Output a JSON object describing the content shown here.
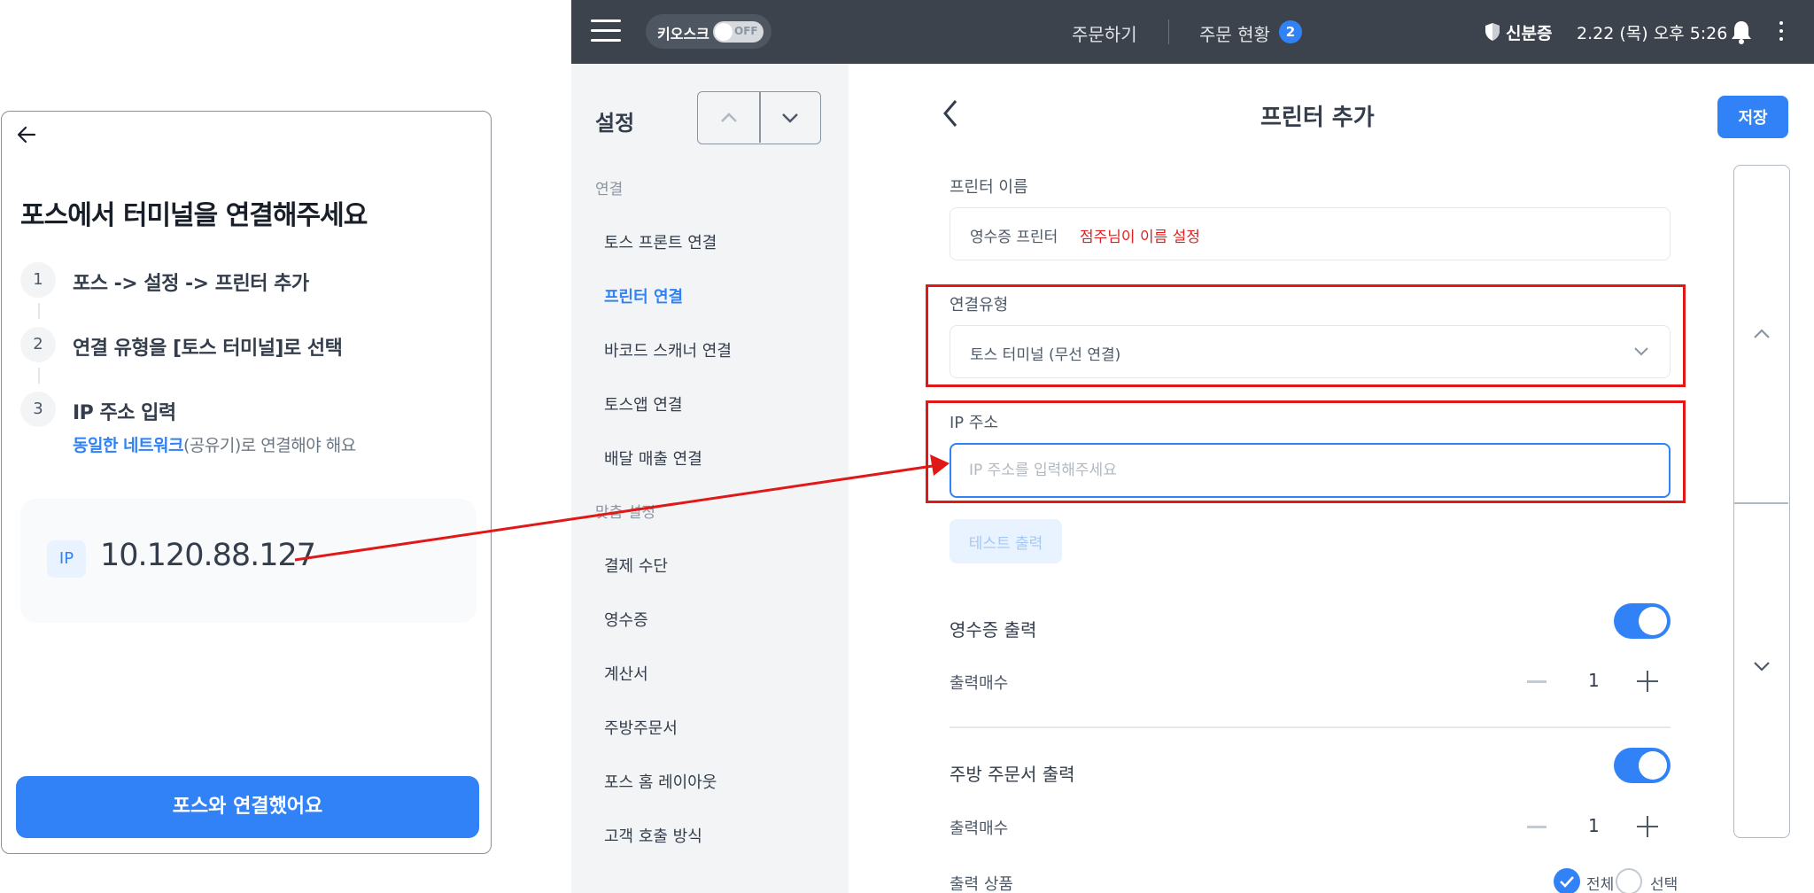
{
  "phone": {
    "title": "포스에서 터미널을 연결해주세요",
    "steps": [
      {
        "num": "1",
        "text": "포스 -> 설정 -> 프린터 추가"
      },
      {
        "num": "2",
        "text": "연결 유형을 [토스 터미널]로 선택"
      },
      {
        "num": "3",
        "text": "IP 주소 입력",
        "sub_highlight": "동일한 네트워크",
        "sub_rest": "(공유기)로 연결해야 해요"
      }
    ],
    "ip_tag": "IP",
    "ip_address": "10.120.88.127",
    "cta_label": "포스와 연결했어요",
    "icons": {
      "back": "arrow-left-icon"
    }
  },
  "topbar": {
    "kiosk_label": "키오스크",
    "kiosk_state": "OFF",
    "nav_order": "주문하기",
    "nav_status": "주문 현황",
    "status_count": "2",
    "id_check": "신분증",
    "datetime": "2.22 (목) 오후 5:26"
  },
  "sidebar": {
    "title": "설정",
    "sections": [
      {
        "label": "연결",
        "items": [
          "토스 프론트 연결",
          "프린터 연결",
          "바코드 스캐너 연결",
          "토스앱 연결",
          "배달 매출 연결"
        ]
      },
      {
        "label": "맞춤 설정",
        "items": [
          "결제 수단",
          "영수증",
          "계산서",
          "주방주문서",
          "포스 홈 레이아웃",
          "고객 호출 방식"
        ]
      }
    ],
    "active_item": "프린터 연결"
  },
  "content": {
    "title": "프린터 추가",
    "save_label": "저장",
    "printer_name_label": "프린터 이름",
    "printer_name_value": "영수증 프린터",
    "printer_name_note": "점주님이 이름 설정",
    "connection_type_label": "연결유형",
    "connection_type_value": "토스 터미널 (무선 연결)",
    "ip_label": "IP 주소",
    "ip_placeholder": "IP 주소를 입력해주세요",
    "test_print_label": "테스트 출력",
    "receipt_print_label": "영수증 출력",
    "receipt_copies_label": "출력매수",
    "receipt_copies_value": "1",
    "kitchen_print_label": "주방 주문서 출력",
    "kitchen_copies_label": "출력매수",
    "kitchen_copies_value": "1",
    "output_products_label": "출력 상품",
    "radio_all": "전체",
    "radio_select": "선택"
  },
  "colors": {
    "accent": "#3182f6",
    "annotation": "#e01818",
    "topbar": "#3c434d"
  }
}
